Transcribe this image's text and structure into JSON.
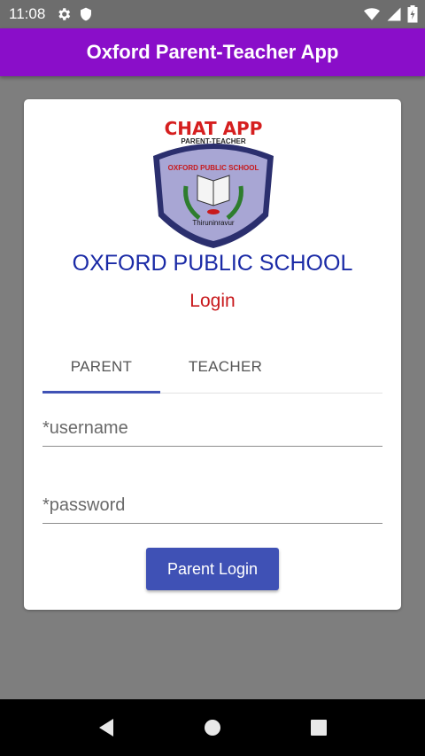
{
  "status_bar": {
    "time": "11:08",
    "left_icons": [
      "gear-icon",
      "shield-icon"
    ],
    "right_icons": [
      "wifi-icon",
      "signal-icon",
      "battery-icon"
    ]
  },
  "app_bar": {
    "title": "Oxford Parent-Teacher App",
    "color": "#8a0ec9"
  },
  "logo": {
    "top_text": "CHAT APP",
    "sub_text": "PARENT-TEACHER",
    "crest_text": "OXFORD PUBLIC SCHOOL",
    "place_text": "Thiruninravur"
  },
  "school_name": "OXFORD PUBLIC SCHOOL",
  "login_heading": "Login",
  "tabs": [
    {
      "label": "PARENT",
      "selected": true
    },
    {
      "label": "TEACHER",
      "selected": false
    }
  ],
  "form": {
    "username_placeholder": "*username",
    "password_placeholder": "*password",
    "submit_label": "Parent Login"
  },
  "colors": {
    "accent": "#3f51b5",
    "school_name": "#1a2aa6",
    "login_heading": "#c8191c"
  },
  "nav": [
    "back-icon",
    "home-icon",
    "recents-icon"
  ]
}
